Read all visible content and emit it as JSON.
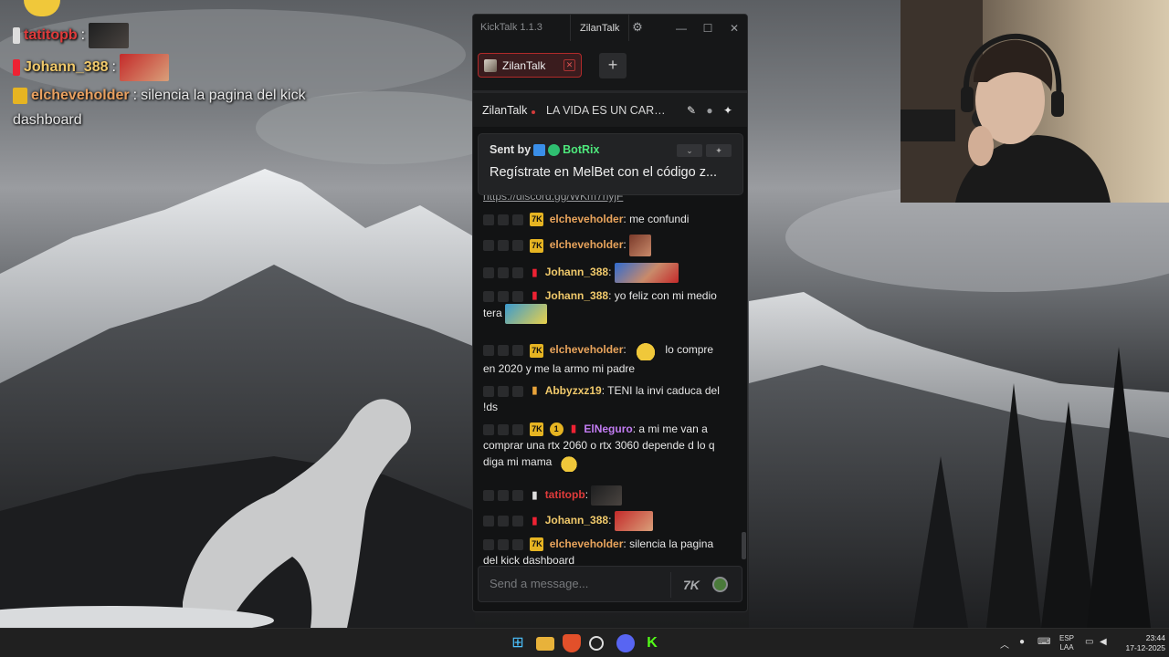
{
  "overlay": {
    "rows": [
      {
        "name": "tatitopb",
        "name_color": "#e03b3b",
        "text": ""
      },
      {
        "name": "Johann_388",
        "name_color": "#f0c96b",
        "text": ""
      },
      {
        "name": "elcheveholder",
        "name_color": "#e8a060",
        "text": "silencia la pagina del kick",
        "text2": "dashboard"
      }
    ]
  },
  "kicktalk": {
    "app_title": "KickTalk 1.1.3",
    "user_label": "ZilanTalk",
    "gear_icon": "⚙",
    "minimize": "—",
    "maximize": "☐",
    "close": "✕",
    "tab_label": "ZilanTalk",
    "tab_close": "✕",
    "tab_add": "+",
    "header": {
      "channel": "ZilanTalk",
      "stream_title": "LA VIDA ES UN CARR...",
      "live_dot_color": "#d23b3b"
    },
    "pinned": {
      "sent_by_label": "Sent by",
      "bot_name": "BotRix",
      "message": "Regístrate en MelBet con el código z...",
      "bot_color": "#4ee87c"
    },
    "link_fragment": "https://discord.gg/WKm7nyjF",
    "messages": [
      {
        "user": "elcheveholder",
        "color": "#e9a45c",
        "text": "me confundi"
      },
      {
        "user": "elcheveholder",
        "color": "#e9a45c",
        "text": ""
      },
      {
        "user": "Johann_388",
        "color": "#f0c96b",
        "text": ""
      },
      {
        "user": "Johann_388",
        "color": "#f0c96b",
        "text": "yo feliz con mi medio",
        "text2": "tera"
      },
      {
        "user": "elcheveholder",
        "color": "#e9a45c",
        "text": "lo compre",
        "text2": "en 2020 y me la armo mi padre"
      },
      {
        "user": "Abbyzxz19",
        "color": "#f0c96b",
        "text": "TENI la invi caduca del",
        "text2": "!ds"
      },
      {
        "user": "ElNeguro",
        "color": "#c27cf2",
        "text": "a mi me van a",
        "text2": "comprar una rtx 2060 o rtx 3060 depende d lo q",
        "text3": "diga mi mama"
      },
      {
        "user": "tatitopb",
        "color": "#e03b3b",
        "text": ""
      },
      {
        "user": "Johann_388",
        "color": "#f0c96b",
        "text": ""
      },
      {
        "user": "elcheveholder",
        "color": "#e9a45c",
        "text": "silencia la pagina",
        "text2": "del kick dashboard"
      }
    ],
    "input_placeholder": "Send a message...",
    "kick_emote_label": "7K"
  },
  "taskbar": {
    "lang_top": "ESP",
    "lang_bottom": "LAA",
    "time": "23:44",
    "date": "17-12-2025"
  }
}
